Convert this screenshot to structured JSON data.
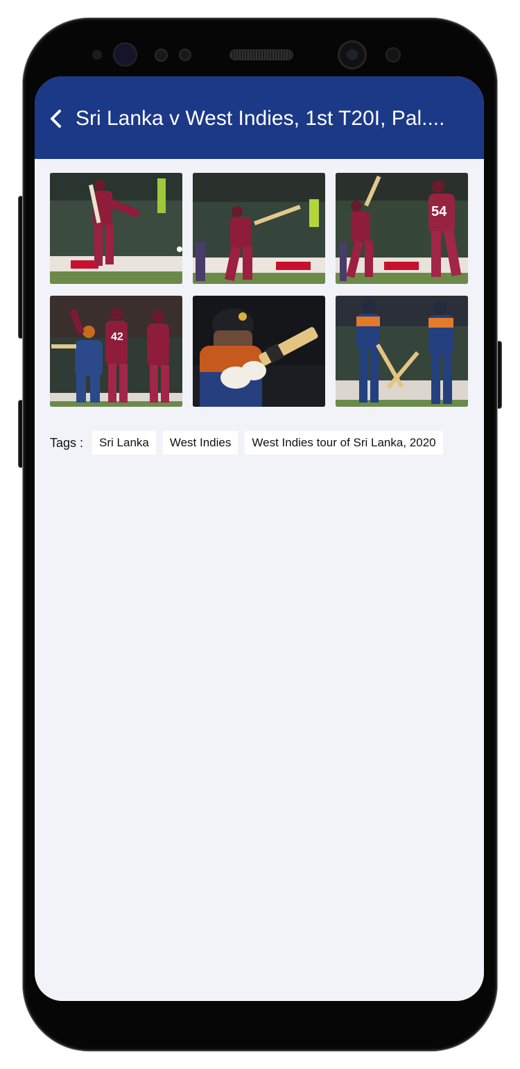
{
  "header": {
    "title": "Sri Lanka v West Indies, 1st T20I, Pal....",
    "back_icon": "chevron-left-icon",
    "background_color": "#1c3988"
  },
  "gallery": {
    "photos": [
      {
        "subject": "West Indies batsman in maroon kit"
      },
      {
        "subject": "West Indies batsman playing a shot"
      },
      {
        "subject": "West Indies batsmen at the crease"
      },
      {
        "subject": "West Indies players celebrating a wicket"
      },
      {
        "subject": "Sri Lanka batsman close-up with helmet"
      },
      {
        "subject": "Sri Lanka batsmen in blue kit"
      }
    ]
  },
  "tags": {
    "label": "Tags :",
    "items": [
      "Sri Lanka",
      "West Indies",
      "West Indies tour of Sri Lanka, 2020"
    ]
  },
  "colors": {
    "screen_background": "#f2f3f8",
    "west_indies_kit": "#8e1c3b",
    "sri_lanka_kit": "#24407e"
  }
}
